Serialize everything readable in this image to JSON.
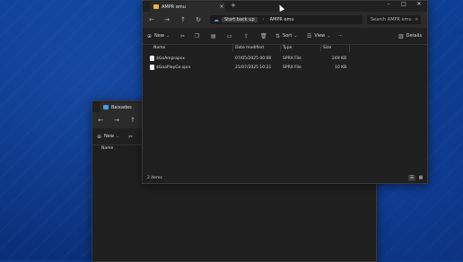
{
  "win_back": {
    "title": "Baixades",
    "nav": {
      "back": "←",
      "forward": "→",
      "up": "↑"
    },
    "new_label": "New",
    "column_name": "Name"
  },
  "win_front": {
    "tab_title": "AMPR emu",
    "new_tab": "+",
    "controls": {
      "minimize": "–",
      "maximize": "□",
      "close": "✕"
    },
    "nav": {
      "back": "←",
      "forward": "→",
      "up": "↑",
      "refresh": "↻"
    },
    "address": {
      "start": "Start back up",
      "current": "AMPR emu"
    },
    "search_placeholder": "Search AMPR emu",
    "toolbar": {
      "new": "New",
      "sort": "Sort",
      "view": "View",
      "more": "···",
      "details": "Details"
    },
    "columns": {
      "name": "Name",
      "date": "Date modified",
      "type": "Type",
      "size": "Size"
    },
    "files": [
      {
        "name": "$GoAmprapsx",
        "date": "07/05/2025 00:00",
        "type": "SPRX File",
        "size": "249 KB"
      },
      {
        "name": "$GoaPlayGo.sprx",
        "date": "21/07/2025 10:21",
        "type": "SPRX File",
        "size": "10 KB"
      }
    ],
    "status": {
      "count": "2 items"
    },
    "accent": "#e8b84a"
  },
  "desktop": {
    "color": "#0b3a8c"
  }
}
